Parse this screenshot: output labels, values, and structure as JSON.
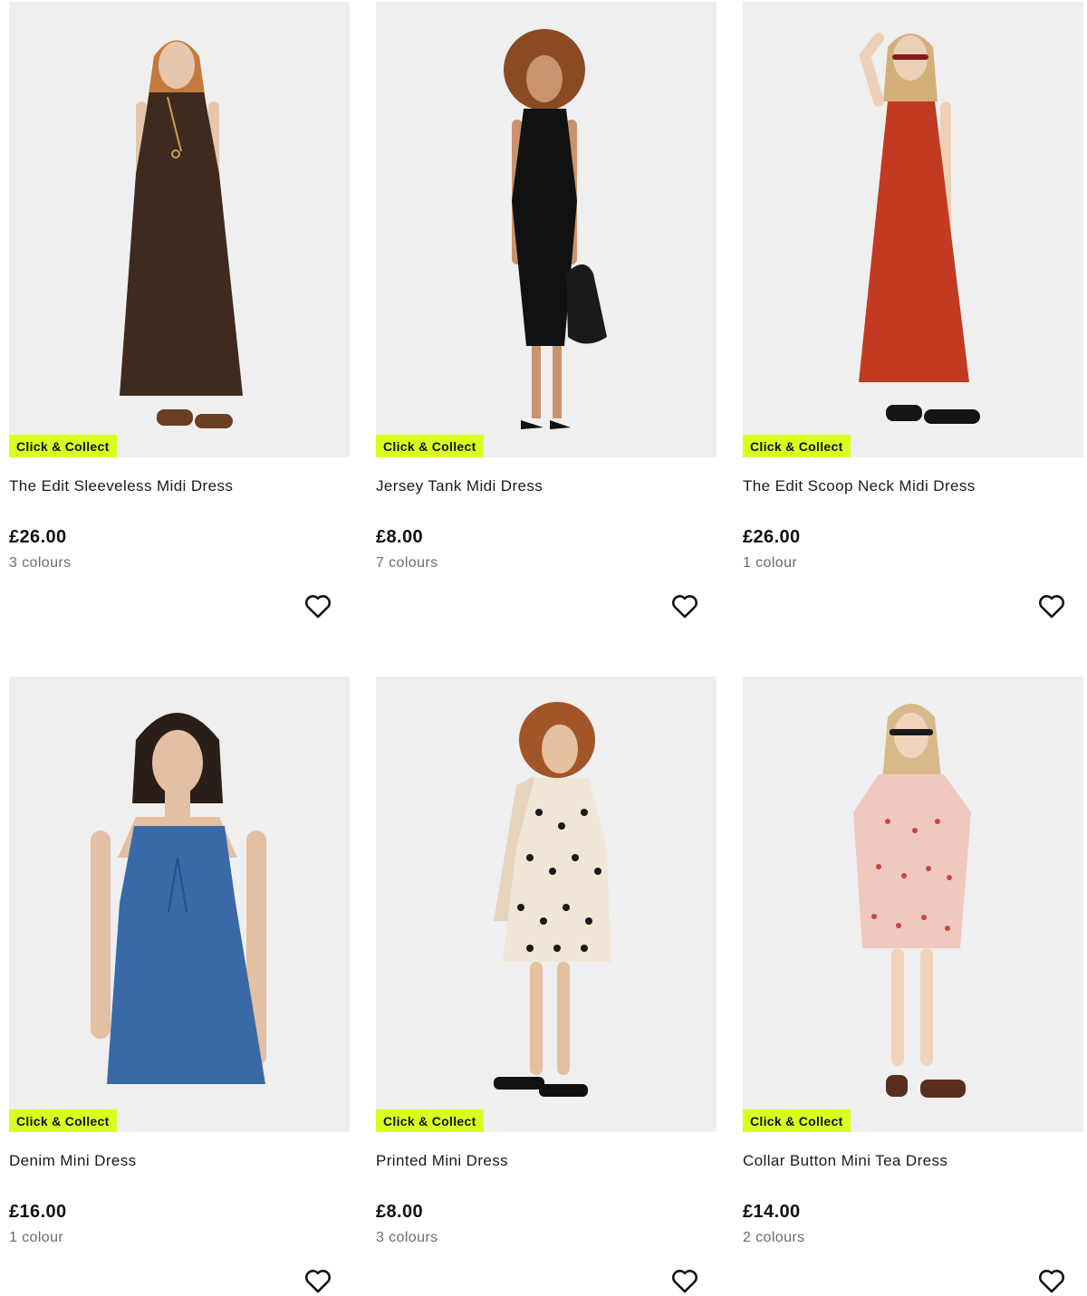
{
  "products": [
    {
      "badge": "Click & Collect",
      "title": "The Edit Sleeveless Midi Dress",
      "price": "£26.00",
      "colours": "3 colours",
      "dress_color": "#3e2a1f",
      "hair_color": "#c47a3d",
      "icon": "heart-icon"
    },
    {
      "badge": "Click & Collect",
      "title": "Jersey Tank Midi Dress",
      "price": "£8.00",
      "colours": "7 colours",
      "dress_color": "#111111",
      "hair_color": "#8a4a22",
      "icon": "heart-icon"
    },
    {
      "badge": "Click & Collect",
      "title": "The Edit Scoop Neck Midi Dress",
      "price": "£26.00",
      "colours": "1 colour",
      "dress_color": "#c23a22",
      "hair_color": "#d2b078",
      "icon": "heart-icon"
    },
    {
      "badge": "Click & Collect",
      "title": "Denim Mini Dress",
      "price": "£16.00",
      "colours": "1 colour",
      "dress_color": "#3a69a8",
      "hair_color": "#2a1e18",
      "icon": "heart-icon"
    },
    {
      "badge": "Click & Collect",
      "title": "Printed Mini Dress",
      "price": "£8.00",
      "colours": "3 colours",
      "dress_color": "#efe6d6",
      "hair_color": "#a3552a",
      "icon": "heart-icon"
    },
    {
      "badge": "Click & Collect",
      "title": "Collar Button Mini Tea Dress",
      "price": "£14.00",
      "colours": "2 colours",
      "dress_color": "#f0c8c0",
      "hair_color": "#d9b98a",
      "icon": "heart-icon"
    }
  ],
  "colors": {
    "badge_bg": "#d9ff1f",
    "image_bg": "#efefef",
    "secondary_text": "#6b6b6b"
  }
}
